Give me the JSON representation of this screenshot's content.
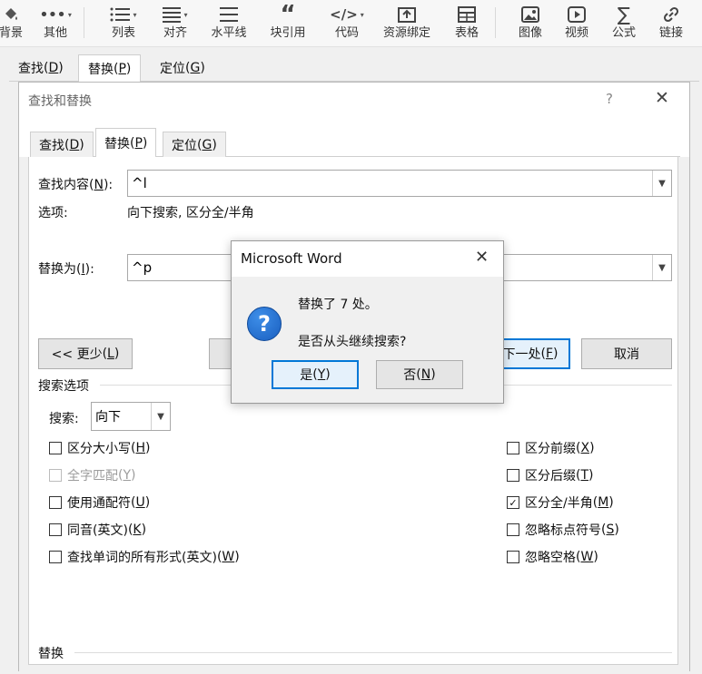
{
  "toolbar": {
    "items": [
      {
        "label": "背景",
        "icon": "paint-bucket-icon"
      },
      {
        "label": "其他",
        "icon": "more-dots-icon"
      },
      {
        "label": "列表",
        "icon": "list-icon"
      },
      {
        "label": "对齐",
        "icon": "align-icon"
      },
      {
        "label": "水平线",
        "icon": "horizontal-line-icon"
      },
      {
        "label": "块引用",
        "icon": "quote-icon"
      },
      {
        "label": "代码",
        "icon": "code-icon"
      },
      {
        "label": "资源绑定",
        "icon": "resource-bind-icon"
      },
      {
        "label": "表格",
        "icon": "table-icon"
      },
      {
        "label": "图像",
        "icon": "image-icon"
      },
      {
        "label": "视频",
        "icon": "video-icon"
      },
      {
        "label": "公式",
        "icon": "formula-icon"
      },
      {
        "label": "链接",
        "icon": "link-icon"
      }
    ]
  },
  "back_tabs": [
    {
      "text": "查找",
      "key": "D"
    },
    {
      "text": "替换",
      "key": "P"
    },
    {
      "text": "定位",
      "key": "G"
    }
  ],
  "dialog": {
    "title": "查找和替换",
    "help": "?",
    "tabs": [
      {
        "text": "查找",
        "key": "D"
      },
      {
        "text": "替换",
        "key": "P"
      },
      {
        "text": "定位",
        "key": "G"
      }
    ],
    "find": {
      "label": "查找内容",
      "key": "N",
      "value": "^l"
    },
    "options_label": "选项:",
    "options_value": "向下搜索, 区分全/半角",
    "replace": {
      "label": "替换为",
      "key": "I",
      "value": "^p"
    },
    "less_button": {
      "text": "<< 更少",
      "key": "L"
    },
    "find_next_button": {
      "text": "下一处",
      "key": "F"
    },
    "cancel_button": "取消",
    "search_options_title": "搜索选项",
    "search": {
      "label": "搜索",
      "value": "向下"
    },
    "left_options": [
      {
        "text": "区分大小写",
        "key": "H",
        "checked": false,
        "disabled": false
      },
      {
        "text": "全字匹配",
        "key": "Y",
        "checked": false,
        "disabled": true
      },
      {
        "text": "使用通配符",
        "key": "U",
        "checked": false,
        "disabled": false
      },
      {
        "text": "同音(英文)",
        "key": "K",
        "checked": false,
        "disabled": false
      },
      {
        "text": "查找单词的所有形式(英文)",
        "key": "W",
        "checked": false,
        "disabled": false
      }
    ],
    "right_options": [
      {
        "text": "区分前缀",
        "key": "X",
        "checked": false
      },
      {
        "text": "区分后缀",
        "key": "T",
        "checked": false
      },
      {
        "text": "区分全/半角",
        "key": "M",
        "checked": true
      },
      {
        "text": "忽略标点符号",
        "key": "S",
        "checked": false
      },
      {
        "text": "忽略空格",
        "key": "W",
        "checked": false
      }
    ],
    "replace_section_title": "替换"
  },
  "message_box": {
    "title": "Microsoft Word",
    "line1": "替换了 7 处。",
    "line2": "是否从头继续搜索?",
    "yes": {
      "text": "是",
      "key": "Y"
    },
    "no": {
      "text": "否",
      "key": "N"
    }
  },
  "colors": {
    "accent": "#0078d7",
    "info_icon": "#1a5fc0"
  }
}
